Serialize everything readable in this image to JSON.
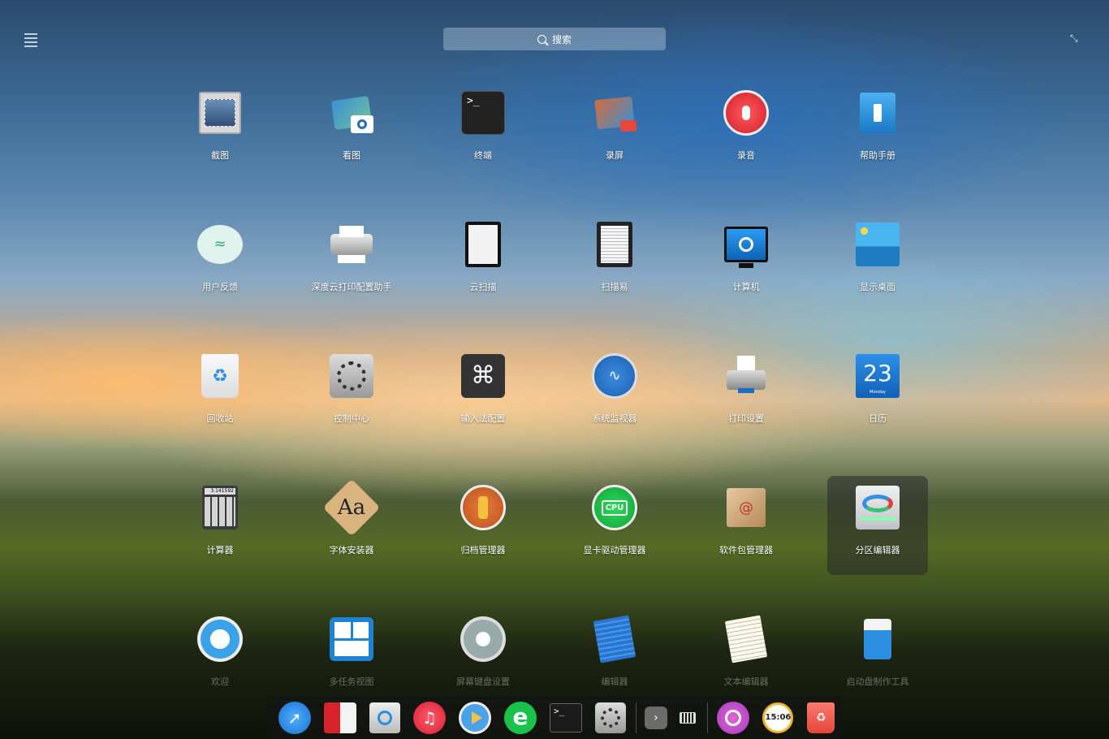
{
  "search": {
    "placeholder": "搜索"
  },
  "apps": [
    {
      "label": "截图",
      "icon": "screenshot-icon"
    },
    {
      "label": "看图",
      "icon": "image-viewer-icon"
    },
    {
      "label": "终端",
      "icon": "terminal-icon"
    },
    {
      "label": "录屏",
      "icon": "screen-recorder-icon"
    },
    {
      "label": "录音",
      "icon": "voice-recorder-icon"
    },
    {
      "label": "帮助手册",
      "icon": "manual-icon"
    },
    {
      "label": "用户反馈",
      "icon": "feedback-icon"
    },
    {
      "label": "深度云打印配置助手",
      "icon": "printer-config-icon"
    },
    {
      "label": "云扫描",
      "icon": "cloud-scan-icon"
    },
    {
      "label": "扫描易",
      "icon": "scanner-icon"
    },
    {
      "label": "计算机",
      "icon": "computer-icon"
    },
    {
      "label": "显示桌面",
      "icon": "show-desktop-icon"
    },
    {
      "label": "回收站",
      "icon": "trash-icon"
    },
    {
      "label": "控制中心",
      "icon": "control-center-icon"
    },
    {
      "label": "输入法配置",
      "icon": "input-method-icon"
    },
    {
      "label": "系统监视器",
      "icon": "system-monitor-icon"
    },
    {
      "label": "打印设置",
      "icon": "print-settings-icon"
    },
    {
      "label": "日历",
      "icon": "calendar-icon",
      "day": "23",
      "weekday": "Monday"
    },
    {
      "label": "计算器",
      "icon": "calculator-icon",
      "display": "3.141592"
    },
    {
      "label": "字体安装器",
      "icon": "font-installer-icon",
      "glyph": "Aa"
    },
    {
      "label": "归档管理器",
      "icon": "archive-manager-icon"
    },
    {
      "label": "显卡驱动管理器",
      "icon": "gpu-driver-icon",
      "chip": "CPU"
    },
    {
      "label": "软件包管理器",
      "icon": "package-manager-icon"
    },
    {
      "label": "分区编辑器",
      "icon": "partition-editor-icon"
    },
    {
      "label": "欢迎",
      "icon": "welcome-icon"
    },
    {
      "label": "多任务视图",
      "icon": "multitask-view-icon"
    },
    {
      "label": "屏幕键盘设置",
      "icon": "onboard-settings-icon"
    },
    {
      "label": "编辑器",
      "icon": "editor-icon"
    },
    {
      "label": "文本编辑器",
      "icon": "text-editor-icon"
    },
    {
      "label": "启动盘制作工具",
      "icon": "boot-maker-icon"
    }
  ],
  "dock": {
    "items": [
      "launcher-icon",
      "file-manager-icon",
      "app-store-icon",
      "music-icon",
      "movie-icon",
      "browser-icon",
      "terminal-icon",
      "settings-icon"
    ],
    "tray": [
      "expand-icon",
      "keyboard-icon",
      "power-icon",
      "clock-icon",
      "trash-icon"
    ],
    "clock_text": "15:06"
  },
  "colors": {
    "selected_bg": "#282828",
    "accent": "#2f8bd8"
  }
}
